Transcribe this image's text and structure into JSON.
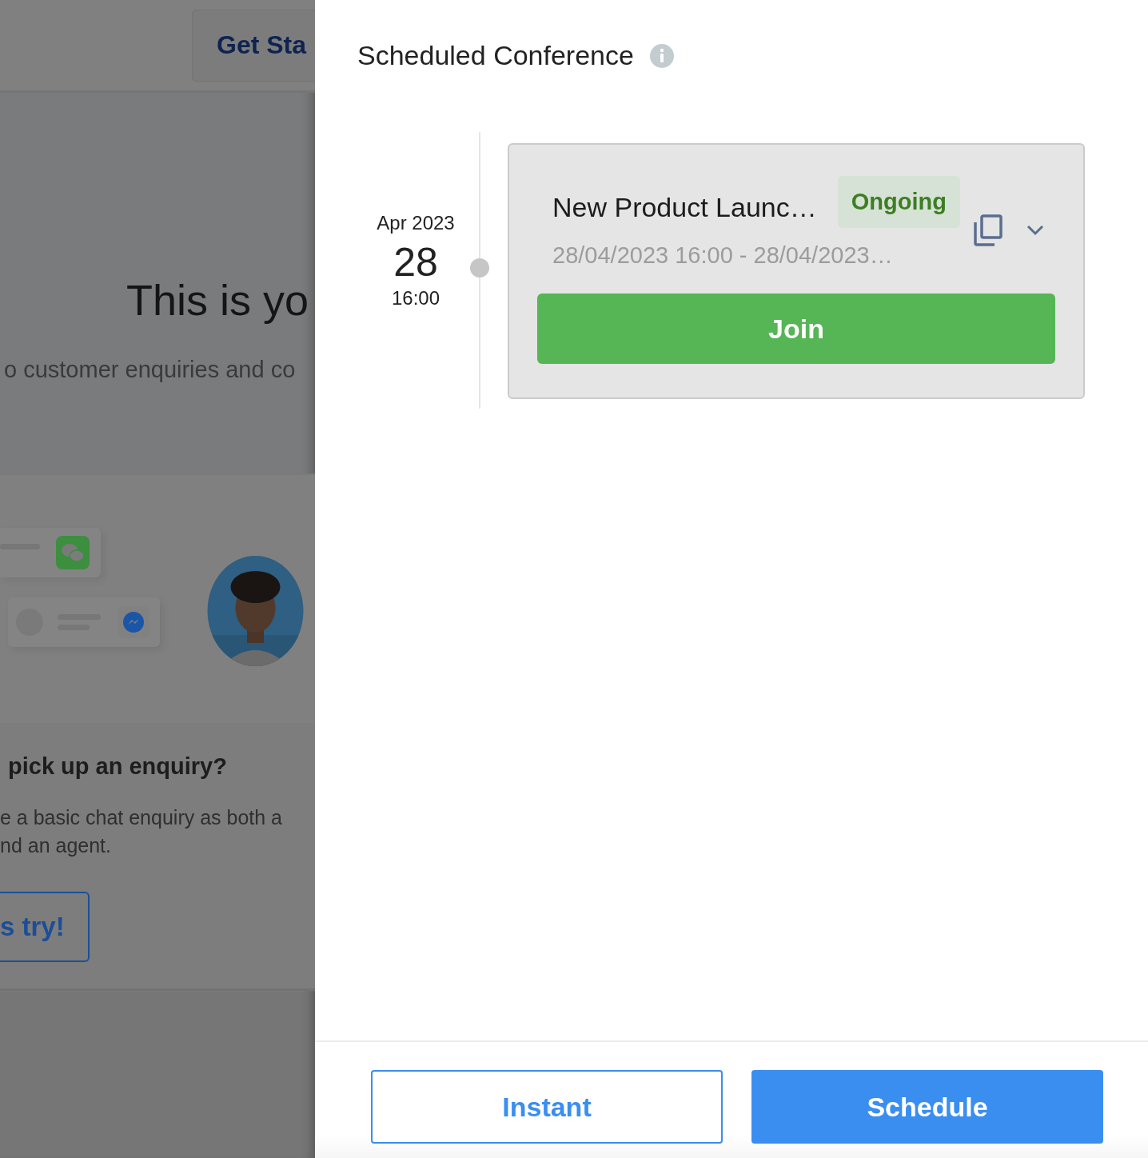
{
  "background": {
    "get_started_button": "Get Sta",
    "hero_title": "This is yo",
    "hero_subtitle": "o customer enquiries and co",
    "section_title": "pick up an enquiry?",
    "section_text": [
      "e a basic chat enquiry as both a",
      "nd an agent."
    ],
    "try_button": "s try!"
  },
  "panel": {
    "title": "Scheduled Conference",
    "conferences": [
      {
        "month": "Apr 2023",
        "day": "28",
        "time": "16:00",
        "title": "New Product Launc…",
        "status": "Ongoing",
        "range": "28/04/2023 16:00 - 28/04/2023…",
        "join_label": "Join",
        "expanded": false
      }
    ],
    "footer_buttons": [
      {
        "label": "Instant",
        "kind": "outline"
      },
      {
        "label": "Schedule",
        "kind": "primary"
      }
    ]
  }
}
